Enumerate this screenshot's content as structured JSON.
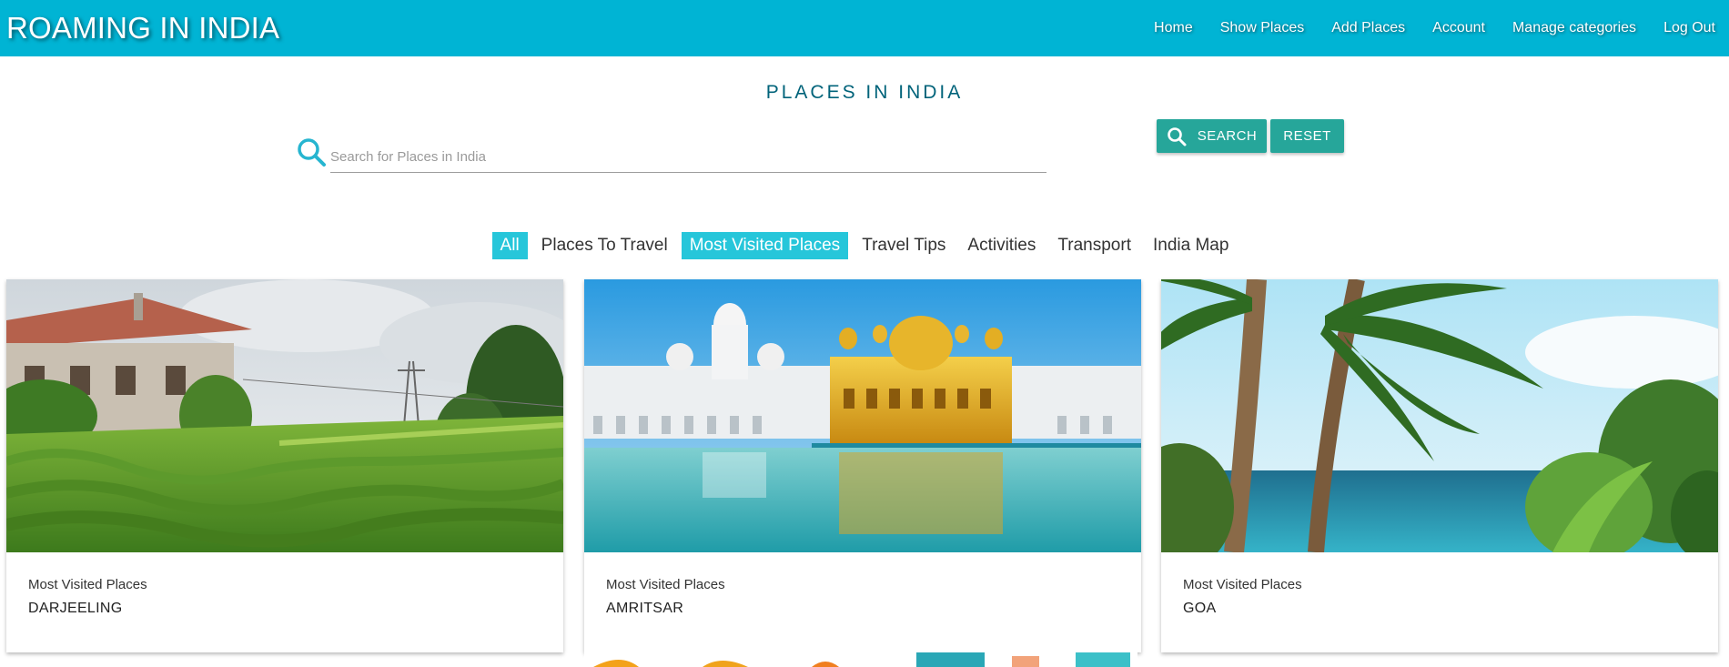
{
  "brand": {
    "title": "ROAMING IN INDIA"
  },
  "nav": {
    "items": [
      {
        "label": "Home"
      },
      {
        "label": "Show Places"
      },
      {
        "label": "Add Places"
      },
      {
        "label": "Account"
      },
      {
        "label": "Manage categories"
      },
      {
        "label": "Log Out"
      }
    ]
  },
  "page": {
    "title": "PLACES IN INDIA"
  },
  "search": {
    "placeholder": "Search for Places in India",
    "value": "",
    "search_label": "SEARCH",
    "reset_label": "RESET"
  },
  "tabs": {
    "items": [
      {
        "label": "All",
        "active": true
      },
      {
        "label": "Places To Travel",
        "active": false
      },
      {
        "label": "Most Visited Places",
        "active": true
      },
      {
        "label": "Travel Tips",
        "active": false
      },
      {
        "label": "Activities",
        "active": false
      },
      {
        "label": "Transport",
        "active": false
      },
      {
        "label": "India Map",
        "active": false
      }
    ]
  },
  "cards": [
    {
      "category": "Most Visited Places",
      "title": "DARJEELING",
      "image": "tea-garden-photo"
    },
    {
      "category": "Most Visited Places",
      "title": "AMRITSAR",
      "image": "golden-temple-photo"
    },
    {
      "category": "Most Visited Places",
      "title": "GOA",
      "image": "beach-palm-photo"
    }
  ],
  "colors": {
    "navbar": "#00b4d4",
    "button": "#26a69a",
    "tab_active": "#26c6da",
    "title": "#00637a"
  }
}
